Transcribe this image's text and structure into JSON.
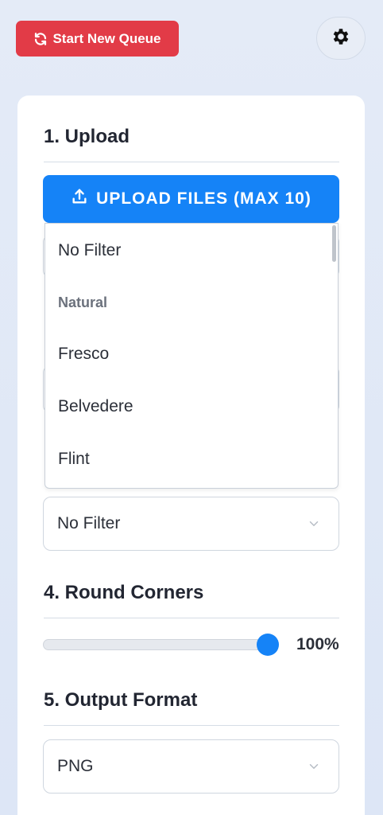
{
  "header": {
    "start_new_queue_label": "Start New Queue",
    "settings_icon": "gear-icon"
  },
  "sections": {
    "upload_title": "1. Upload",
    "upload_button_label": "UPLOAD FILES (MAX 10)",
    "round_corners_title": "4. Round Corners",
    "output_format_title": "5. Output Format"
  },
  "filter_dropdown": {
    "items": [
      {
        "label": "No Filter",
        "type": "option"
      },
      {
        "label": "Natural",
        "type": "group"
      },
      {
        "label": "Fresco",
        "type": "option"
      },
      {
        "label": "Belvedere",
        "type": "option"
      },
      {
        "label": "Flint",
        "type": "option"
      }
    ]
  },
  "filter_select": {
    "value": "No Filter"
  },
  "round_corners": {
    "value_label": "100%",
    "fraction": 1.0
  },
  "output_format": {
    "value": "PNG"
  },
  "colors": {
    "danger": "#e23b47",
    "primary": "#1583f7"
  }
}
